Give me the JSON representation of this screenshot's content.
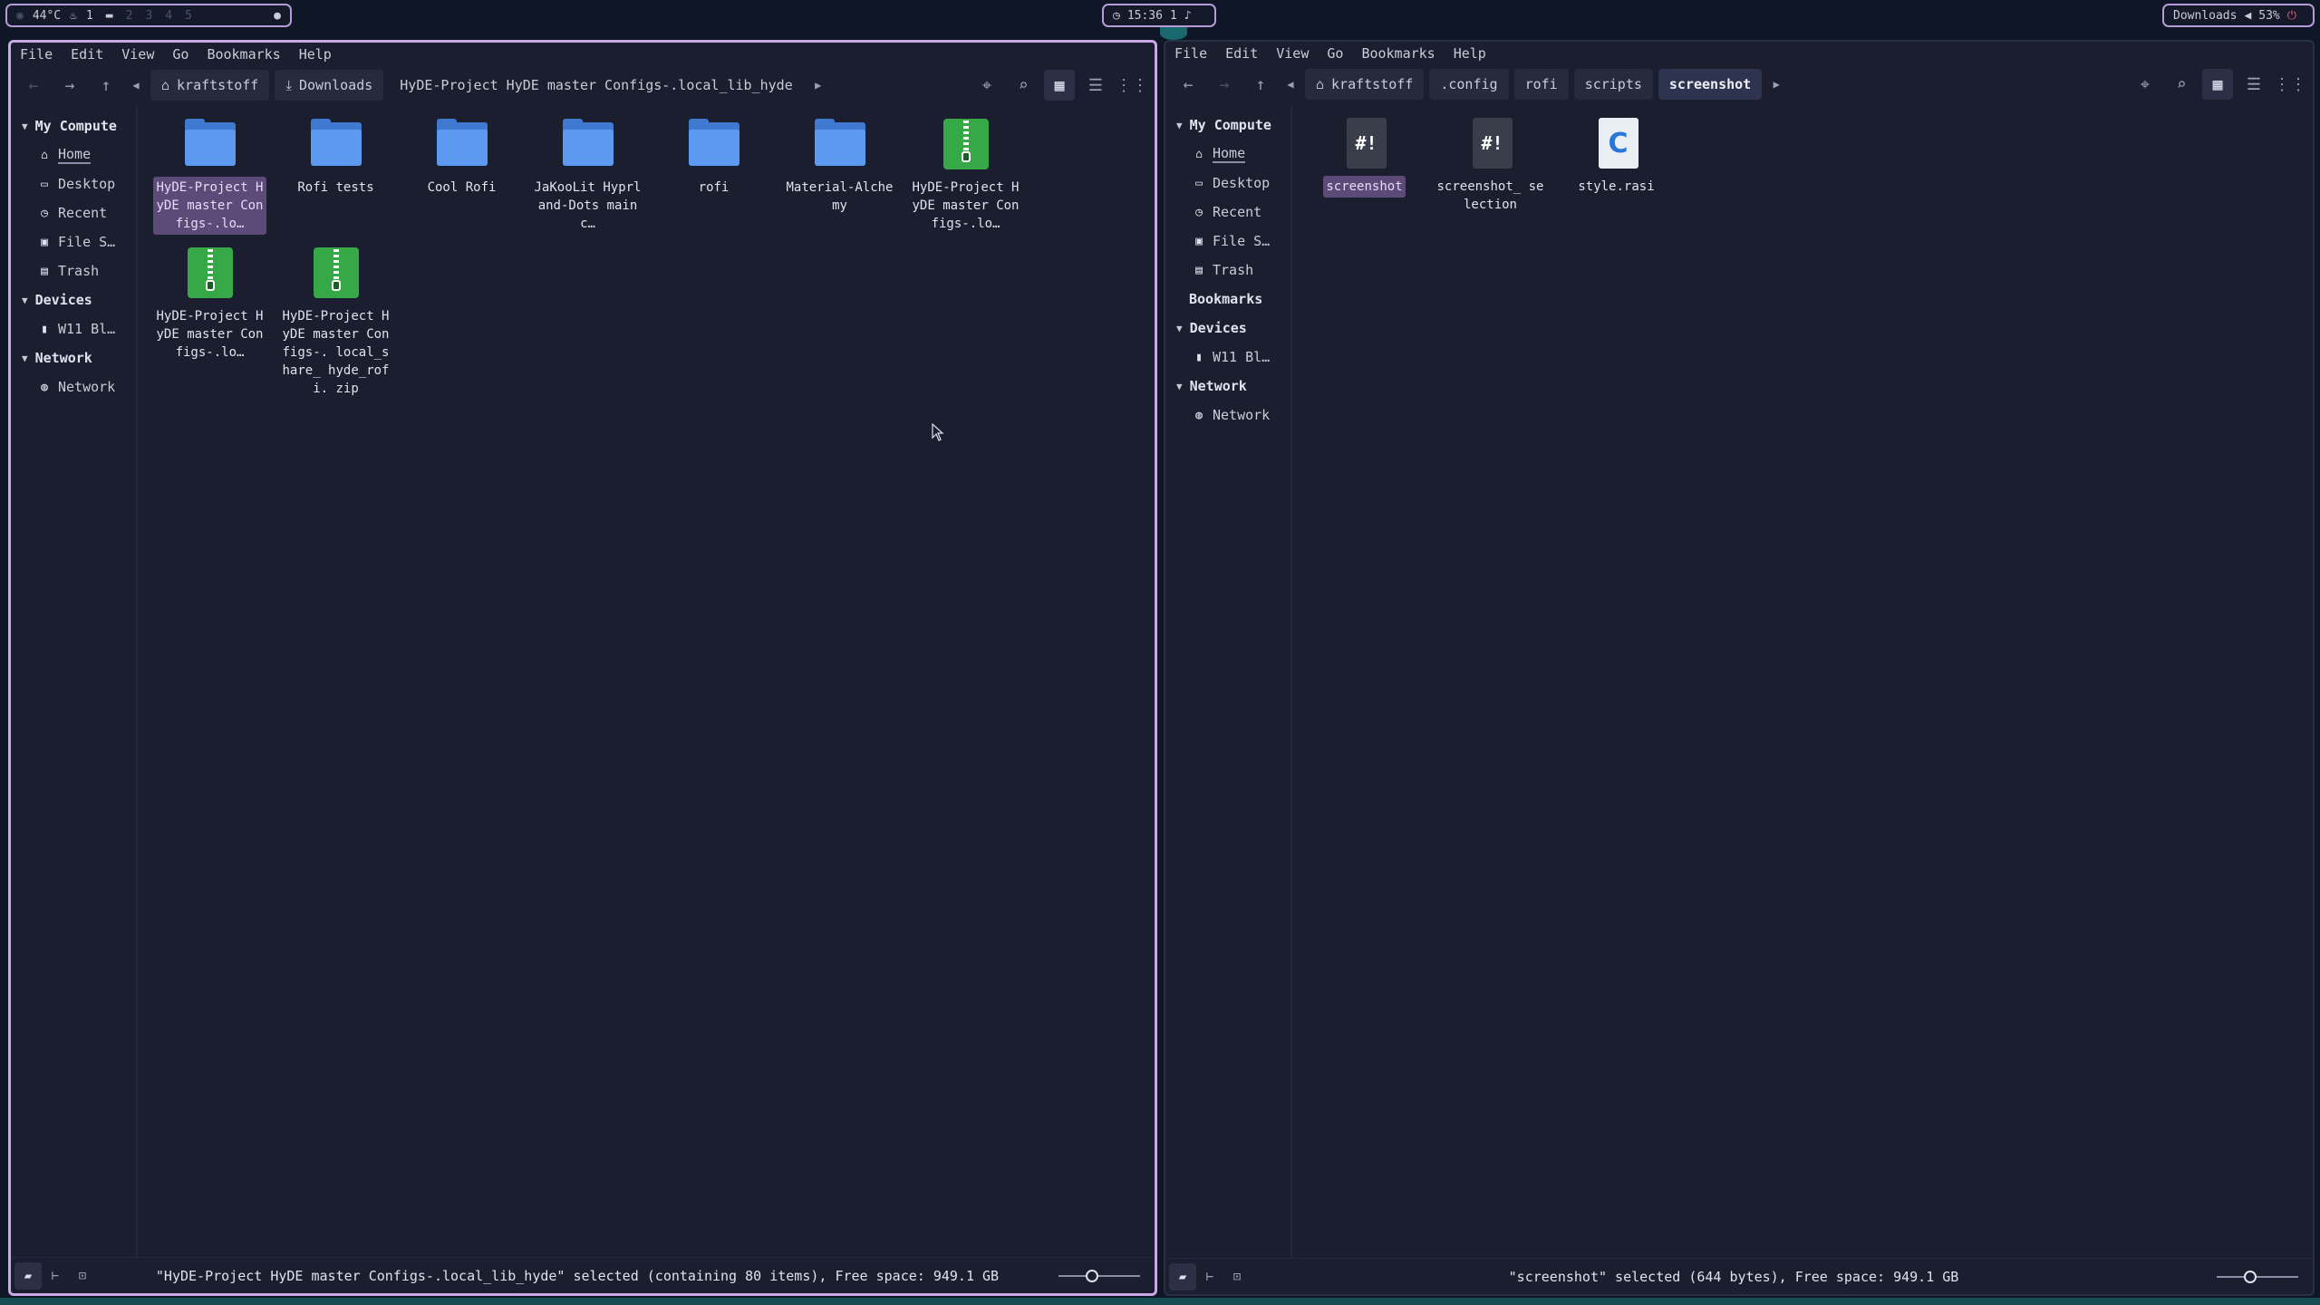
{
  "topbar": {
    "temp": "44°C",
    "workspaces": [
      "1",
      "2",
      "3",
      "4",
      "5"
    ],
    "clock": "15:36",
    "notifications": "1",
    "media": "Downloads",
    "volume": "53%"
  },
  "left": {
    "menu": [
      "File",
      "Edit",
      "View",
      "Go",
      "Bookmarks",
      "Help"
    ],
    "crumbs": [
      "kraftstoff",
      "Downloads",
      "HyDE-Project HyDE master Configs-.local_lib_hyde"
    ],
    "sidebar": {
      "my_computer": "My Compute",
      "items": [
        "Home",
        "Desktop",
        "Recent",
        "File S…",
        "Trash"
      ],
      "devices": "Devices",
      "device_items": [
        "W11 Bl…"
      ],
      "network": "Network",
      "network_items": [
        "Network"
      ]
    },
    "files": [
      {
        "name": "HyDE-Project HyDE master Configs-.lo…",
        "type": "folder"
      },
      {
        "name": "Rofi tests",
        "type": "folder"
      },
      {
        "name": "Cool Rofi",
        "type": "folder"
      },
      {
        "name": "JaKooLit Hyprland-Dots main c…",
        "type": "folder"
      },
      {
        "name": "rofi",
        "type": "folder"
      },
      {
        "name": "Material-Alchemy",
        "type": "folder"
      },
      {
        "name": "HyDE-Project HyDE master Configs-.lo…",
        "type": "zip"
      },
      {
        "name": "HyDE-Project HyDE master Configs-.lo…",
        "type": "zip"
      },
      {
        "name": "HyDE-Project HyDE master Configs-. local_share_ hyde_rofi. zip",
        "type": "zip"
      }
    ],
    "status": "\"HyDE-Project HyDE master Configs-.local_lib_hyde\" selected (containing 80 items), Free space: 949.1 GB"
  },
  "right": {
    "menu": [
      "File",
      "Edit",
      "View",
      "Go",
      "Bookmarks",
      "Help"
    ],
    "crumbs": [
      "kraftstoff",
      ".config",
      "rofi",
      "scripts",
      "screenshot"
    ],
    "sidebar": {
      "my_computer": "My Compute",
      "items": [
        "Home",
        "Desktop",
        "Recent",
        "File S…",
        "Trash"
      ],
      "bookmarks": "Bookmarks",
      "devices": "Devices",
      "device_items": [
        "W11 Bl…"
      ],
      "network": "Network",
      "network_items": [
        "Network"
      ]
    },
    "files": [
      {
        "name": "screenshot",
        "type": "script",
        "glyph": "#!"
      },
      {
        "name": "screenshot_ selection",
        "type": "script",
        "glyph": "#!"
      },
      {
        "name": "style.rasi",
        "type": "c",
        "glyph": "C"
      }
    ],
    "status": "\"screenshot\" selected (644 bytes), Free space: 949.1 GB"
  }
}
